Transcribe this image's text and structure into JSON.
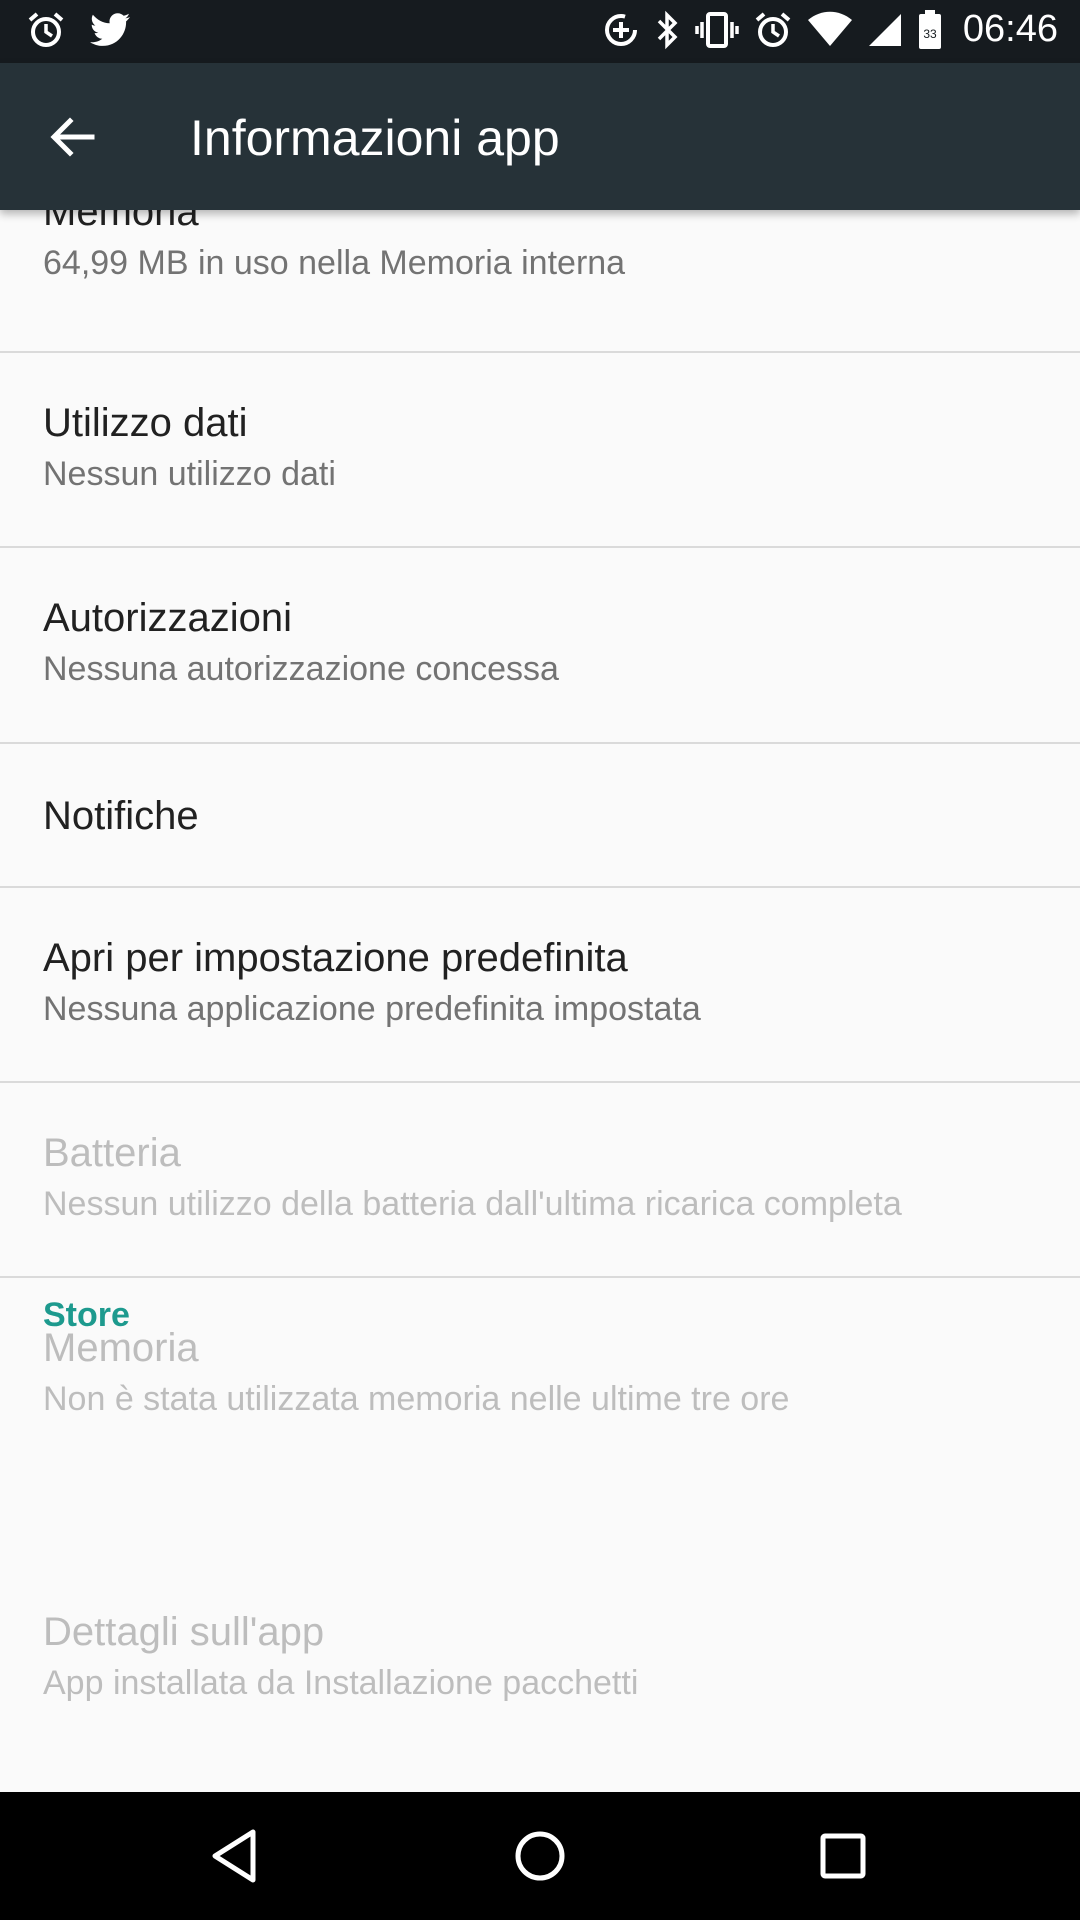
{
  "status_bar": {
    "time": "06:46",
    "battery_level": "33",
    "left_icons": [
      "alarm-icon",
      "twitter-icon"
    ],
    "right_icons": [
      "data-saver-icon",
      "bluetooth-icon",
      "vibrate-icon",
      "alarm-icon",
      "wifi-icon",
      "cell-signal-icon",
      "battery-icon"
    ]
  },
  "app_bar": {
    "title": "Informazioni app",
    "back_icon": "arrow-back-icon"
  },
  "items": [
    {
      "title": "Memoria",
      "subtitle": "64,99 MB in uso nella Memoria interna",
      "enabled": true
    },
    {
      "title": "Utilizzo dati",
      "subtitle": "Nessun utilizzo dati",
      "enabled": true
    },
    {
      "title": "Autorizzazioni",
      "subtitle": "Nessuna autorizzazione concessa",
      "enabled": true
    },
    {
      "title": "Notifiche",
      "subtitle": "",
      "enabled": true
    },
    {
      "title": "Apri per impostazione predefinita",
      "subtitle": "Nessuna applicazione predefinita impostata",
      "enabled": true
    },
    {
      "title": "Batteria",
      "subtitle": "Nessun utilizzo della batteria dall'ultima ricarica completa",
      "enabled": false
    },
    {
      "title": "Memoria",
      "subtitle": "Non è stata utilizzata memoria nelle ultime tre ore",
      "enabled": false
    }
  ],
  "store_section": {
    "header": "Store",
    "item": {
      "title": "Dettagli sull'app",
      "subtitle": "App installata da Installazione pacchetti",
      "enabled": false
    }
  },
  "nav_bar": {
    "buttons": [
      "back-triangle-icon",
      "home-circle-icon",
      "recents-square-icon"
    ]
  },
  "colors": {
    "status_bar": "#161B1F",
    "app_bar": "#263238",
    "background": "#FAFAFA",
    "accent": "#1D9A8E",
    "disabled_text": "#BDBDBD"
  }
}
